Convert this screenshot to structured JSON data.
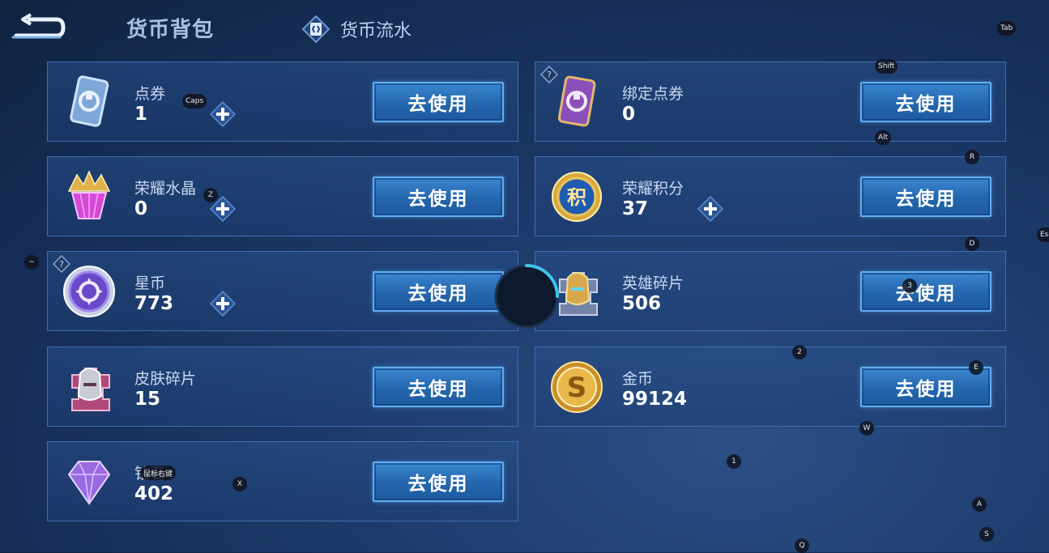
{
  "header": {
    "active_tab": "货币背包",
    "flow_tab": "货币流水"
  },
  "cards": [
    {
      "name": "点券",
      "amount": "1",
      "has_plus": true,
      "has_help": false,
      "icon": "voucher-card-icon"
    },
    {
      "name": "绑定点券",
      "amount": "0",
      "has_plus": false,
      "has_help": true,
      "icon": "bound-voucher-card-icon"
    },
    {
      "name": "荣耀水晶",
      "amount": "0",
      "has_plus": true,
      "has_help": false,
      "icon": "glory-crystal-icon"
    },
    {
      "name": "荣耀积分",
      "amount": "37",
      "has_plus": true,
      "has_help": false,
      "icon": "glory-points-coin-icon"
    },
    {
      "name": "星币",
      "amount": "773",
      "has_plus": true,
      "has_help": true,
      "icon": "star-coin-icon"
    },
    {
      "name": "英雄碎片",
      "amount": "506",
      "has_plus": false,
      "has_help": false,
      "icon": "hero-fragment-icon"
    },
    {
      "name": "皮肤碎片",
      "amount": "15",
      "has_plus": false,
      "has_help": false,
      "icon": "skin-fragment-icon"
    },
    {
      "name": "金币",
      "amount": "99124",
      "has_plus": false,
      "has_help": false,
      "icon": "gold-coin-icon"
    },
    {
      "name": "钻石",
      "amount": "402",
      "has_plus": false,
      "has_help": false,
      "icon": "diamond-icon"
    }
  ],
  "use_button_label": "去使用",
  "key_hints": [
    "Tab",
    "Shift",
    "Alt",
    "R",
    "D",
    "Caps",
    "Z",
    "~",
    "3",
    "2",
    "E",
    "W",
    "1",
    "A",
    "S",
    "Q",
    "X",
    "鼠标右键",
    "Esc"
  ],
  "colors": {
    "background": "#1d3a69",
    "card_border": "#3f6db0",
    "button": "#2466ad",
    "button_border": "#5fb0f2"
  }
}
